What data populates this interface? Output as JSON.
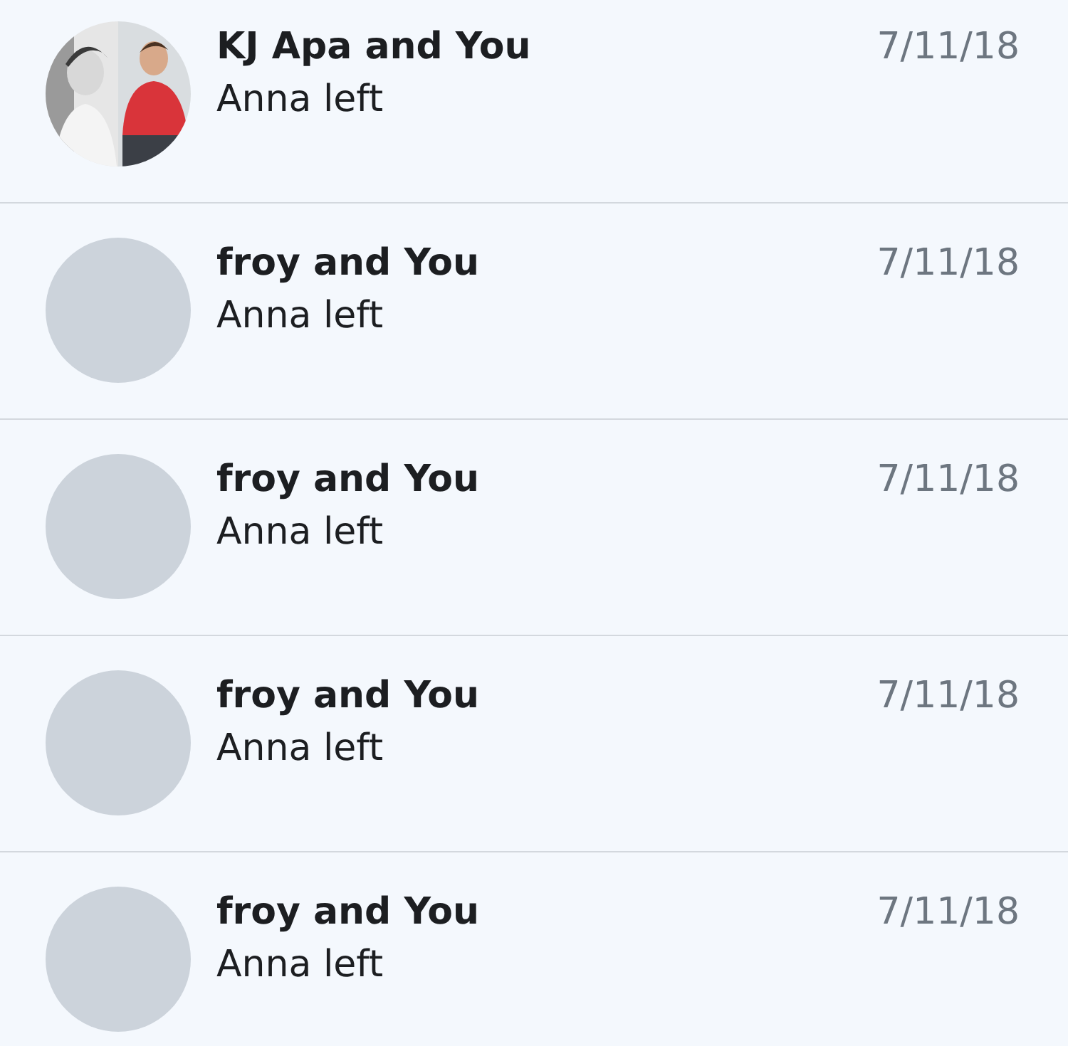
{
  "conversations": [
    {
      "title": "KJ Apa and You",
      "preview": "Anna left",
      "date": "7/11/18"
    },
    {
      "title": "froy and You",
      "preview": "Anna left",
      "date": "7/11/18",
      "avatar": {
        "kind": "placeholder"
      }
    },
    {
      "title": "froy and You",
      "preview": "Anna left",
      "date": "7/11/18",
      "avatar": {
        "kind": "placeholder"
      }
    },
    {
      "title": "froy and You",
      "preview": "Anna left",
      "date": "7/11/18",
      "avatar": {
        "kind": "placeholder"
      }
    },
    {
      "title": "froy and You",
      "preview": "Anna left",
      "date": "7/11/18",
      "avatar": {
        "kind": "placeholder"
      }
    }
  ]
}
